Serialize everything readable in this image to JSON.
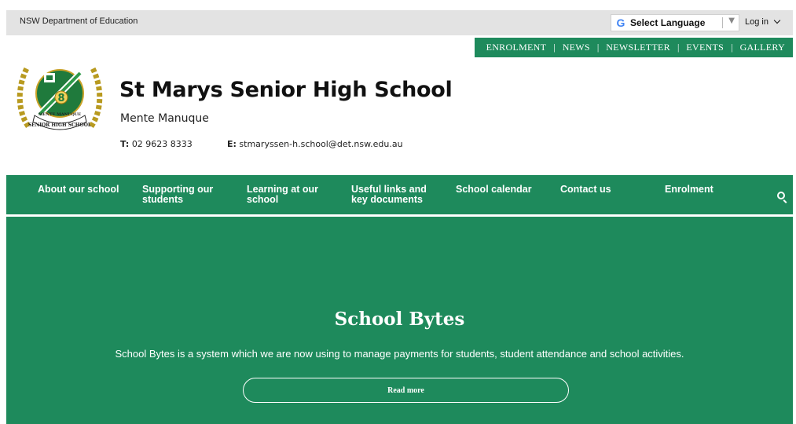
{
  "topbar": {
    "department": "NSW Department of Education",
    "language_label": "Select Language",
    "login_label": "Log in"
  },
  "quick_links": [
    "ENROLMENT",
    "NEWS",
    "NEWSLETTER",
    "EVENTS",
    "GALLERY"
  ],
  "school": {
    "name": "St Marys Senior High School",
    "motto": "Mente Manuque",
    "phone_label": "T:",
    "phone": "02 9623 8333",
    "email_label": "E:",
    "email": "stmaryssen-h.school@det.nsw.edu.au",
    "logo_text_top": "MENTE MANUQUE",
    "logo_text_bottom": "SENIOR HIGH SCHOOL",
    "logo_number": "8"
  },
  "main_nav": [
    "About our school",
    "Supporting our students",
    "Learning at our school",
    "Useful links and key documents",
    "School calendar",
    "Contact us",
    "Enrolment"
  ],
  "hero": {
    "title": "School Bytes",
    "text": "School Bytes is a system which we are now using to manage payments for students, student attendance and school activities.",
    "button_label": "Read more"
  },
  "colors": {
    "brand_green": "#1e8a5c",
    "topbar_gray": "#e3e3e3"
  }
}
